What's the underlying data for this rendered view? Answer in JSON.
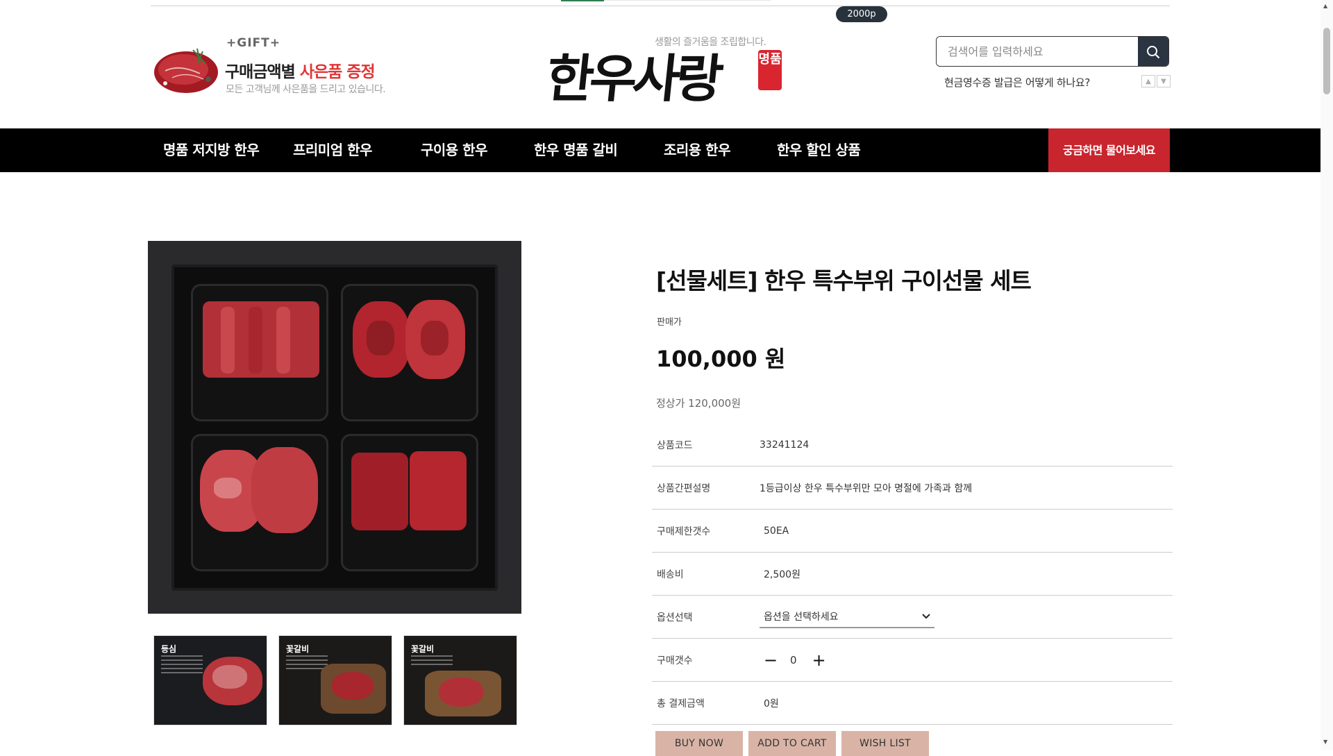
{
  "points_badge": "2000p",
  "gift_banner": {
    "tag": "+GIFT+",
    "title_main": "구매금액별 ",
    "title_highlight": "사은품 증정",
    "subtitle": "모든 고객님께 사은품을 드리고 있습니다."
  },
  "logo": {
    "slogan": "생활의 즐거움을 조립합니다.",
    "text": "한우사랑",
    "seal": "명품"
  },
  "search": {
    "placeholder": "검색어를 입력하세요",
    "value": ""
  },
  "rolling_notice": "현금영수증 발급은 어떻게 하나요?",
  "nav": {
    "items": [
      "명품 저지방 한우",
      "프리미엄 한우",
      "구이용 한우",
      "한우 명품 갈비",
      "조리용 한우",
      "한우 할인 상품"
    ],
    "cta": "궁금하면 물어보세요"
  },
  "thumbnails": [
    {
      "title": "등심"
    },
    {
      "title": "꽃갈비"
    },
    {
      "title": "꽃갈비"
    }
  ],
  "product": {
    "title": "[선물세트] 한우 특수부위 구이선물 세트",
    "price_label": "판매가",
    "price": "100,000 원",
    "original_price": "정상가 120,000원",
    "details": [
      {
        "label": "상품코드",
        "value": "33241124"
      },
      {
        "label": "상품간편설명",
        "value": "1등급이상 한우 특수부위만 모아 명절에 가족과 함께"
      },
      {
        "label": "구매제한갯수",
        "value": "50EA"
      },
      {
        "label": "배송비",
        "value": "2,500원"
      }
    ],
    "option": {
      "label": "옵션선택",
      "selected": "옵션을 선택하세요"
    },
    "quantity": {
      "label": "구매갯수",
      "value": "0",
      "minus": "−",
      "plus": "+"
    },
    "total": {
      "label": "총 결제금액",
      "value": "0원"
    }
  },
  "buttons": {
    "buy_now": "BUY NOW",
    "add_to_cart": "ADD TO CART",
    "wish_list": "WISH LIST"
  },
  "colors": {
    "nav_bg": "#000000",
    "cta_bg": "#c9252e",
    "button_bg": "#d9b4a6",
    "seal_bg": "#d9252f",
    "search_btn_bg": "#2b3541"
  }
}
